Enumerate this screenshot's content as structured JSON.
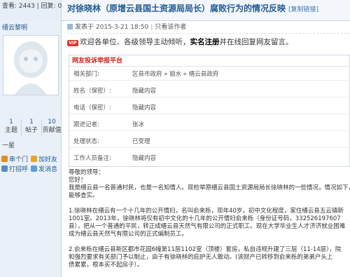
{
  "stats": {
    "text": "查看: 2443 | 回复: 0"
  },
  "thread": {
    "title": "对徐晓林（原增云县国土资源局局长）腐败行为的情况反映",
    "copy_link": "[复制链接]"
  },
  "author": {
    "name": "缙云黎明",
    "stats": [
      {
        "num": "1",
        "label": "主题"
      },
      {
        "num": "1",
        "label": "帖子"
      },
      {
        "num": "10",
        "label": "贡献值"
      }
    ],
    "level": "一星",
    "actions": [
      {
        "label": "串个门",
        "icon": "chat-icon",
        "color": "#e08a2b"
      },
      {
        "label": "加好友",
        "icon": "add-friend-icon",
        "color": "#e5a52b"
      },
      {
        "label": "打招呼",
        "icon": "greet-icon",
        "color": "#5a8ac6"
      },
      {
        "label": "发消息",
        "icon": "message-icon",
        "color": "#5aa0d6"
      }
    ]
  },
  "post": {
    "meta": {
      "posted": "发表于 2015-3-21 18:50",
      "author_only": "只看该作者"
    },
    "welcome": {
      "badge": "VIP",
      "lead": "欢迎各单位、各级领导主动倾听，",
      "bold": "实名注册",
      "tail": "并在线回复网友留言。"
    },
    "report": {
      "heading": "网友投诉举报平台",
      "rows": [
        {
          "k": "相关部门:",
          "v": "区县市政府 » 丽水 » 缙云县政府"
        },
        {
          "k": "姓名（保密）:",
          "v": "隐藏内容"
        },
        {
          "k": "电话（保密）:",
          "v": "隐藏内容"
        },
        {
          "k": "跟进记者:",
          "v": "张冰"
        },
        {
          "k": "处理状态:",
          "v": "已受理"
        },
        {
          "k": "工作人员备注:",
          "v": "隐藏内容"
        }
      ]
    },
    "body": [
      "尊敬的领导：",
      "您好！",
      "我是缙云县一名普通村民，也是一名知情人。现检举原缙云县国土资源局局长徐晓林的一些情况，情况如下，",
      "能够查实。",
      "",
      "1.徐晓林在缙云有一个十几年的公开情妇，名叫俞来栎，现年40岁，初中文化程度，家住缙云县五云镇新",
      "1001室。2013年，徐晓林将仅有初中文化的十几年的公开情妇俞来栎（身份证号码，332526197607",
      "县），把从一个普通的平民，转正成缙云县天然气有限公司的正式职工。现在大学毕业生人才济济就业困难",
      "成为缙云县天然气有限公司的正式编制员工。",
      "",
      "2.俞来栎在缙云县新区都市花园6幢第11层1102室（顶楼）套房，私自违规升建了三层（11-14层），院",
      "和强烈要求有关部门予以制止，由于有徐晓林的庇护无人敢动。(该财产已转移到俞来栎的弟弟户头上",
      "债累累，根本买不起房子）。"
    ]
  }
}
